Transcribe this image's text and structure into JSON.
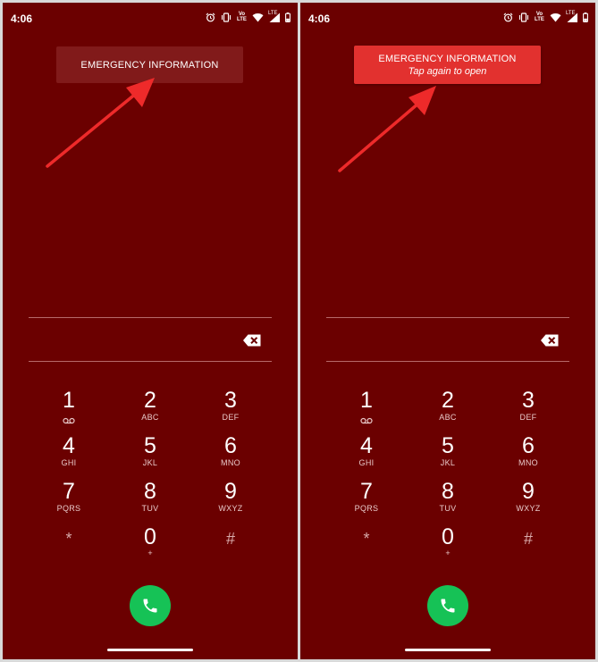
{
  "left": {
    "status": {
      "time": "4:06",
      "lte": "LTE",
      "volte": "Vo LTE"
    },
    "emergency": {
      "title": "EMERGENCY INFORMATION",
      "subtitle": ""
    },
    "keys": [
      {
        "digit": "1",
        "letters": ""
      },
      {
        "digit": "2",
        "letters": "ABC"
      },
      {
        "digit": "3",
        "letters": "DEF"
      },
      {
        "digit": "4",
        "letters": "GHI"
      },
      {
        "digit": "5",
        "letters": "JKL"
      },
      {
        "digit": "6",
        "letters": "MNO"
      },
      {
        "digit": "7",
        "letters": "PQRS"
      },
      {
        "digit": "8",
        "letters": "TUV"
      },
      {
        "digit": "9",
        "letters": "WXYZ"
      },
      {
        "digit": "*",
        "letters": ""
      },
      {
        "digit": "0",
        "letters": "+"
      },
      {
        "digit": "#",
        "letters": ""
      }
    ]
  },
  "right": {
    "status": {
      "time": "4:06",
      "lte": "LTE",
      "volte": "Vo LTE"
    },
    "emergency": {
      "title": "EMERGENCY INFORMATION",
      "subtitle": "Tap again to open"
    },
    "keys": [
      {
        "digit": "1",
        "letters": ""
      },
      {
        "digit": "2",
        "letters": "ABC"
      },
      {
        "digit": "3",
        "letters": "DEF"
      },
      {
        "digit": "4",
        "letters": "GHI"
      },
      {
        "digit": "5",
        "letters": "JKL"
      },
      {
        "digit": "6",
        "letters": "MNO"
      },
      {
        "digit": "7",
        "letters": "PQRS"
      },
      {
        "digit": "8",
        "letters": "TUV"
      },
      {
        "digit": "9",
        "letters": "WXYZ"
      },
      {
        "digit": "*",
        "letters": ""
      },
      {
        "digit": "0",
        "letters": "+"
      },
      {
        "digit": "#",
        "letters": ""
      }
    ]
  },
  "colors": {
    "background": "#6b0000",
    "emergency_idle": "#811a1a",
    "emergency_active": "#e2312f",
    "call_button": "#16c256",
    "arrow": "#ee2a2a"
  },
  "icons": [
    "alarm-icon",
    "vibrate-icon",
    "volte-icon",
    "wifi-icon",
    "signal-icon",
    "battery-icon",
    "backspace-icon",
    "voicemail-icon",
    "phone-icon"
  ]
}
